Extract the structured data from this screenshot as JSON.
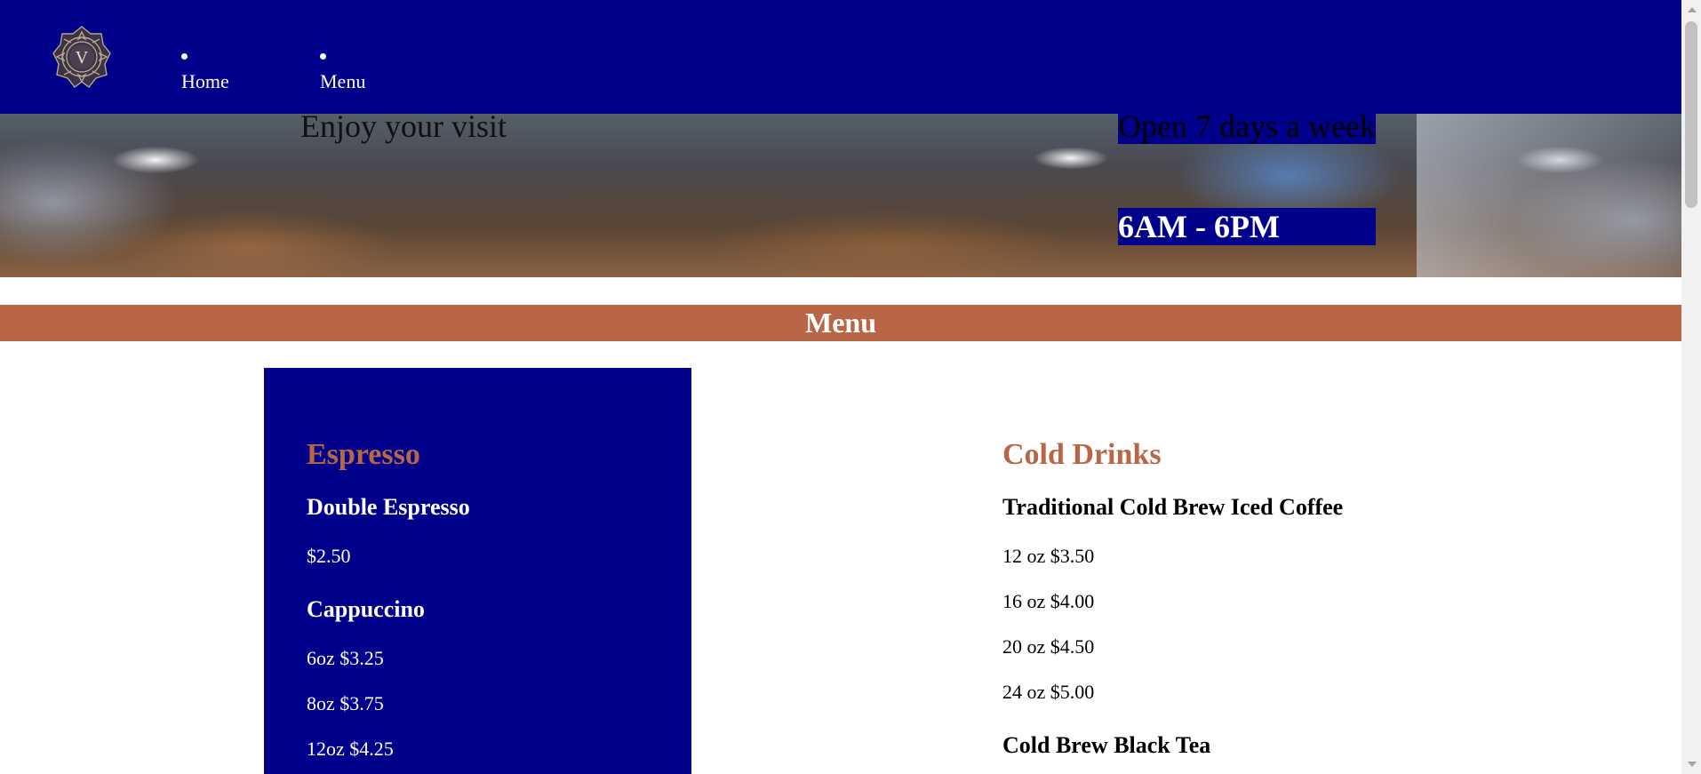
{
  "nav": {
    "logo_letter": "V",
    "items": [
      {
        "label": "Home"
      },
      {
        "label": "Menu"
      }
    ],
    "background": "#00008b"
  },
  "hero": {
    "welcome": "Enjoy your visit",
    "hours_heading": "Open 7 days a week",
    "hours_time": "6AM - 6PM"
  },
  "menu_section": {
    "title": "Menu",
    "accent": "#b86645"
  },
  "espresso": {
    "title": "Espresso",
    "items": [
      {
        "name": "Double Espresso",
        "prices": [
          "$2.50"
        ]
      },
      {
        "name": "Cappuccino",
        "prices": [
          "6oz $3.25",
          "8oz $3.75",
          "12oz $4.25"
        ]
      }
    ]
  },
  "cold_drinks": {
    "title": "Cold Drinks",
    "items": [
      {
        "name": "Traditional Cold Brew Iced Coffee",
        "prices": [
          "12 oz $3.50",
          "16 oz $4.00",
          "20 oz $4.50",
          "24 oz $5.00"
        ]
      },
      {
        "name": "Cold Brew Black Tea",
        "prices": []
      }
    ]
  }
}
